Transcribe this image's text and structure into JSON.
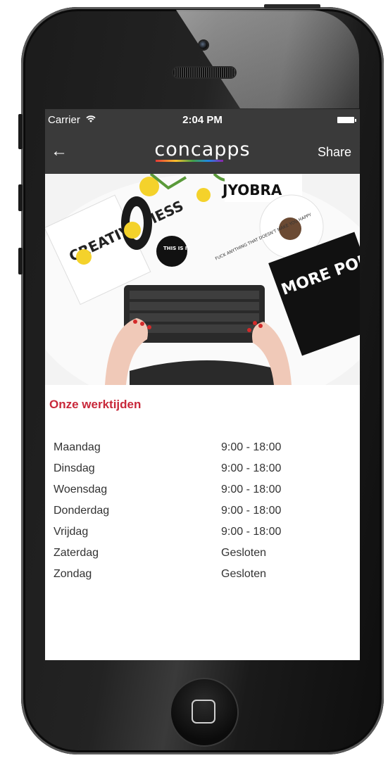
{
  "status_bar": {
    "carrier": "Carrier",
    "time": "2:04 PM",
    "wifi_icon": "wifi-icon",
    "battery_icon": "battery-icon"
  },
  "nav_bar": {
    "back_icon": "←",
    "logo": "concapps",
    "share_label": "Share"
  },
  "hero": {
    "mug_text_left": "CREATIVE MESS",
    "sticker_text": "THIS IS IT",
    "poster_top_text": "JYOBRA",
    "poster_right_text": "MORE PORTANT THAN",
    "note_text": "FUCK ANYTHING THAT DOESN'T MAKE YOU HAPPY"
  },
  "content": {
    "section_title": "Onze werktijden",
    "hours": [
      {
        "day": "Maandag",
        "time": "9:00 - 18:00"
      },
      {
        "day": "Dinsdag",
        "time": "9:00 - 18:00"
      },
      {
        "day": "Woensdag",
        "time": "9:00 - 18:00"
      },
      {
        "day": "Donderdag",
        "time": "9:00 - 18:00"
      },
      {
        "day": "Vrijdag",
        "time": "9:00 - 18:00"
      },
      {
        "day": "Zaterdag",
        "time": "Gesloten"
      },
      {
        "day": "Zondag",
        "time": "Gesloten"
      }
    ]
  },
  "colors": {
    "nav_background": "#3a3a3a",
    "title_accent": "#c8283a",
    "text": "#333333"
  }
}
